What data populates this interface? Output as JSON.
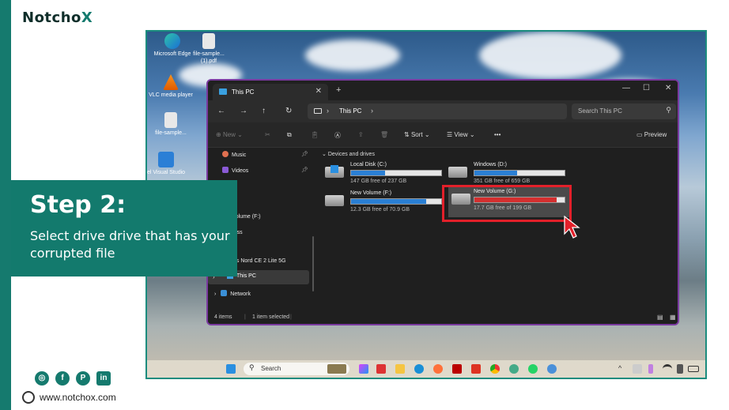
{
  "brand": {
    "logo_prefix": "Notcho",
    "logo_x": "X"
  },
  "step": {
    "title": "Step 2:",
    "description": "Select drive drive that has your corrupted file"
  },
  "footer": {
    "website": "www.notchox.com"
  },
  "social": [
    "instagram-icon",
    "facebook-icon",
    "pinterest-icon",
    "linkedin-icon"
  ],
  "desktop_icons": [
    {
      "label": "Microsoft Edge"
    },
    {
      "label": "file-sample... (1).pdf"
    },
    {
      "label": "VLC media player"
    },
    {
      "label": "file-sample..."
    },
    {
      "label": "el Visual Studio"
    }
  ],
  "explorer": {
    "tab_title": "This PC",
    "address_path": "This PC",
    "search_placeholder": "Search This PC",
    "toolbar": {
      "new": "New",
      "sort": "Sort",
      "view": "View",
      "more": "•••",
      "preview": "Preview"
    },
    "nav": {
      "music": "Music",
      "videos": "Videos",
      "item3": "les",
      "item4": "y",
      "new_volume": "lew Volume (F:)",
      "item6": "deossss",
      "oneplus": "nePlus Nord CE 2 Lite 5G",
      "this_pc": "This PC",
      "network": "Network"
    },
    "group_title": "Devices and drives",
    "drives": [
      {
        "name": "Local Disk (C:)",
        "free": "147 GB free of 237 GB",
        "used_fraction": 0.38
      },
      {
        "name": "Windows (D:)",
        "free": "351 GB free of 659 GB",
        "used_fraction": 0.47
      },
      {
        "name": "New Volume (F:)",
        "free": "12.3 GB free of 70.9 GB",
        "used_fraction": 0.83
      },
      {
        "name": "New Volume (G:)",
        "free": "17.7 GB free of 199 GB",
        "used_fraction": 0.91
      }
    ],
    "status": {
      "items": "4 items",
      "selected": "1 item selected"
    }
  },
  "taskbar": {
    "search": "Search"
  },
  "colors": {
    "brand": "#157a6e",
    "highlight": "#e2202a",
    "drive_fill": "#2a7fd4",
    "drive_fill_low": "#d32f2f"
  }
}
